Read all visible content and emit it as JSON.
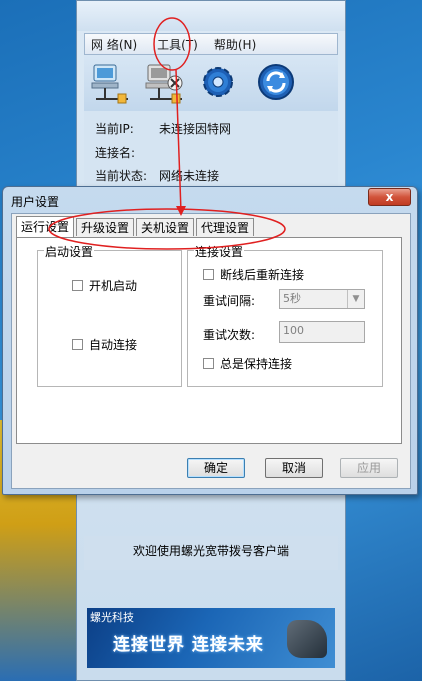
{
  "main_window": {
    "menu": [
      "网 络(N)",
      "工具(T)",
      "帮助(H)"
    ],
    "toolbar_icons": [
      "network-connect-icon",
      "network-disconnect-icon",
      "settings-gear-icon",
      "refresh-icon"
    ],
    "info": {
      "ip_label": "当前IP:",
      "ip_value": "未连接因特网",
      "conn_label": "连接名:",
      "conn_value": "",
      "status_label": "当前状态:",
      "status_value": "网络未连接"
    },
    "welcome": "欢迎使用螺光宽带拨号客户端",
    "banner": {
      "brand": "螺光科技",
      "slogan": "连接世界  连接未来"
    }
  },
  "dialog": {
    "title": "用户设置",
    "close_label": "x",
    "tabs": [
      "运行设置",
      "升级设置",
      "关机设置",
      "代理设置"
    ],
    "active_tab": "运行设置",
    "startup_group": {
      "title": "启动设置",
      "options": [
        "开机启动",
        "自动连接"
      ]
    },
    "connect_group": {
      "title": "连接设置",
      "reconnect_label": "断线后重新连接",
      "retry_interval_label": "重试间隔:",
      "retry_interval_value": "5秒",
      "retry_count_label": "重试次数:",
      "retry_count_value": "100",
      "keep_connected_label": "总是保持连接"
    },
    "buttons": {
      "ok": "确定",
      "cancel": "取消",
      "apply": "应用"
    }
  },
  "annotation_color": "#e02020"
}
